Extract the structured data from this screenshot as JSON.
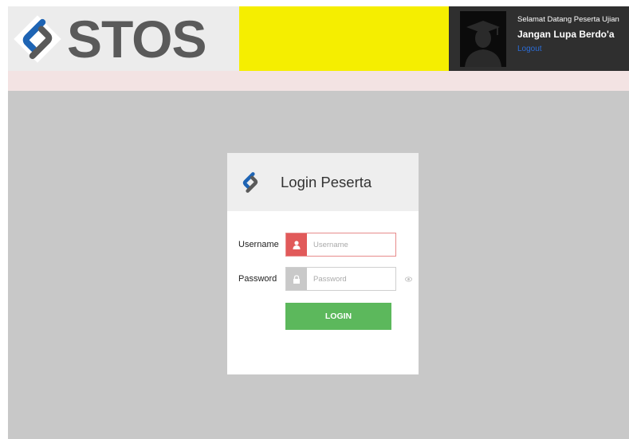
{
  "brand": {
    "name": "STOS"
  },
  "user": {
    "welcome": "Selamat Datang Peserta Ujian",
    "motto": "Jangan Lupa Berdo'a",
    "logout_label": "Logout"
  },
  "login": {
    "title": "Login Peserta",
    "username_label": "Username",
    "username_placeholder": "Username",
    "password_label": "Password",
    "password_placeholder": "Password",
    "submit_label": "LOGIN"
  },
  "icons": {
    "brand": "s-logo-icon",
    "avatar": "graduate-avatar-icon",
    "username": "user-icon",
    "password": "lock-icon",
    "reveal": "eye-icon"
  },
  "colors": {
    "header_yellow": "#f5ee00",
    "header_dark": "#2f2f2f",
    "logo_blue": "#1e64b4",
    "logout_link": "#2b6cd6",
    "username_addon": "#e15a5a",
    "login_button": "#5cb85c"
  }
}
